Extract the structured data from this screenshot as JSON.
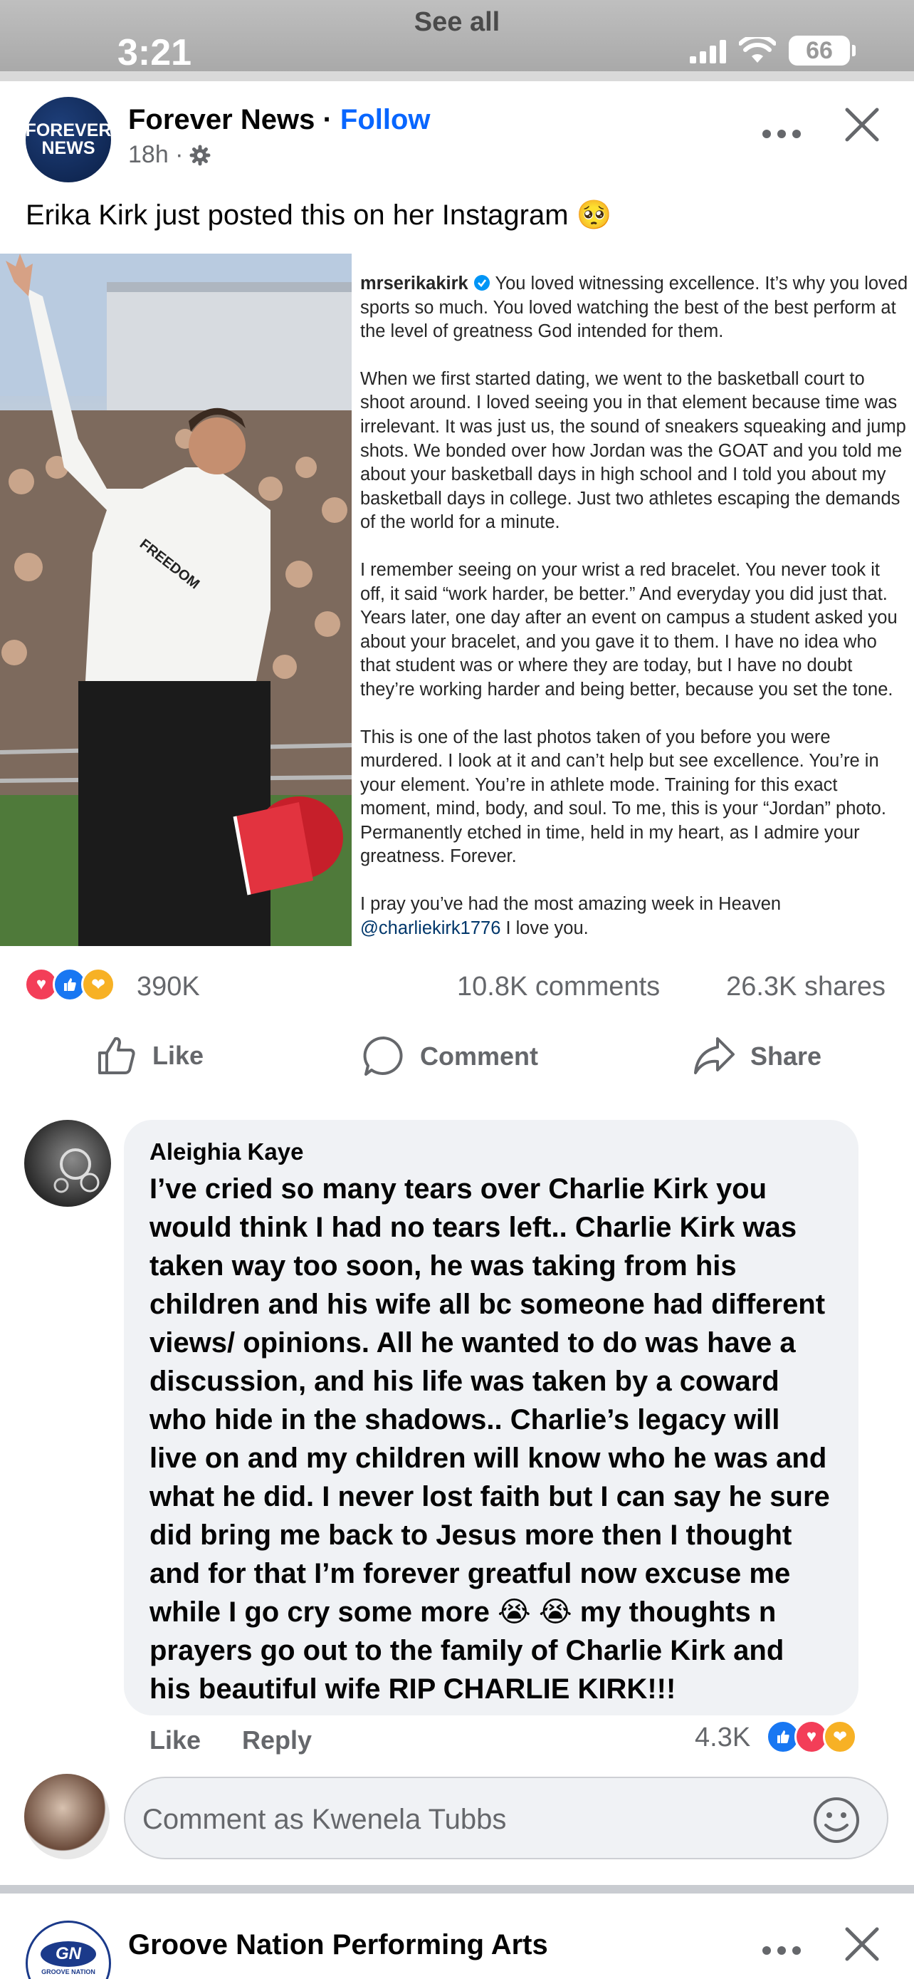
{
  "status_bar": {
    "see_all": "See all",
    "time": "3:21",
    "battery": "66"
  },
  "post": {
    "page_name": "Forever News",
    "separator": " · ",
    "follow_label": "Follow",
    "avatar_text_line1": "FOREVER",
    "avatar_text_line2": "NEWS",
    "timestamp": "18h ·",
    "text": "Erika Kirk just posted this on her Instagram 🥺",
    "image": {
      "shirt_text": "FREEDOM",
      "caption_user": "mrserikakirk",
      "caption_paragraphs": [
        "You loved witnessing excellence. It’s why you loved sports so much. You loved watching the best of the best perform at the level of greatness God intended for them.",
        "When we first started dating, we went to the basketball court to shoot around. I loved seeing you in that element because time was irrelevant. It was just us, the sound of sneakers squeaking and jump shots. We bonded over how Jordan was the GOAT and you told me about your basketball days in high school and I told you about my basketball days in college. Just two athletes escaping the demands of the world for a minute.",
        "I remember seeing on your wrist a red bracelet. You never took it off, it said “work harder, be better.” And everyday you did just that. Years later, one day after an event on campus a student asked you about your bracelet, and you gave it to them. I have no idea who that student was or where they are today, but I have no doubt they’re working harder and being better, because you set the tone.",
        "This is one of the last photos taken of you before you were murdered. I look at it and can’t help but see excellence. You’re in your element. You’re in athlete mode. Training for this exact moment, mind, body, and soul. To me, this is your “Jordan” photo. Permanently etched in time, held in my heart, as I admire your greatness. Forever.",
        "I pray you’ve had the most amazing week in Heaven"
      ],
      "caption_mention": "@charliekirk1776",
      "caption_end": " I love you."
    },
    "reaction_count": "390K",
    "comment_count": "10.8K comments",
    "share_count": "26.3K shares",
    "actions": {
      "like": "Like",
      "comment": "Comment",
      "share": "Share"
    }
  },
  "comment": {
    "author": "Aleighia Kaye",
    "body": "I’ve cried so many tears over Charlie Kirk you would think I had no tears left.. Charlie Kirk was taken way too soon, he was taking from his children and his wife all bc someone had different views/ opinions. All he wanted to do was have a discussion, and his life was taken by a coward who hide in the shadows.. Charlie’s legacy will live on and my children will know who he was and what he did. I never lost faith but I can say he sure did bring me back to Jesus more then I thought and for that I’m forever greatful now excuse me while I go cry some more 😭 😭 my thoughts n prayers go out to the family of Charlie Kirk and his beautiful wife RIP CHARLIE KIRK!!!",
    "like_label": "Like",
    "reply_label": "Reply",
    "reaction_count": "4.3K"
  },
  "composer": {
    "placeholder": "Comment as Kwenela Tubbs"
  },
  "next_post": {
    "page_name": "Groove Nation Performing Arts",
    "avatar_logo": "GN",
    "avatar_sub": "GROOVE NATION"
  },
  "colors": {
    "facebook_blue": "#0866ff",
    "secondary_text": "#65676b",
    "bubble_bg": "#f0f2f5",
    "love": "#f33e58",
    "like": "#1877f2",
    "care": "#f7b125"
  }
}
